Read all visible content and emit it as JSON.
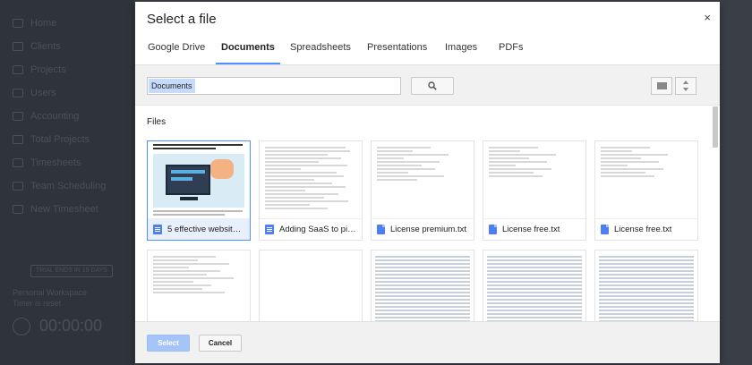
{
  "background_app": {
    "sidebar_items": [
      "Home",
      "Clients",
      "Projects",
      "Users",
      "Accounting",
      "Total Projects",
      "Timesheets",
      "Team Scheduling",
      "New Timesheet"
    ],
    "trial_badge": "TRIAL ENDS IN 15 DAYS",
    "status_line_1": "Personal Workspace",
    "status_line_2": "Timer is reset",
    "timer": "00:00:00"
  },
  "modal": {
    "title": "Select a file",
    "close_symbol": "×",
    "tabs": [
      {
        "label": "Google Drive",
        "active": false
      },
      {
        "label": "Documents",
        "active": true
      },
      {
        "label": "Spreadsheets",
        "active": false
      },
      {
        "label": "Presentations",
        "active": false
      },
      {
        "label": "Images",
        "active": false
      },
      {
        "label": "PDFs",
        "active": false
      }
    ],
    "search": {
      "value": "Documents"
    },
    "section_label": "Files",
    "files": [
      {
        "name": "5 effective website ...",
        "icon": "doc-icon",
        "selected": true
      },
      {
        "name": "Adding SaaS to pick...",
        "icon": "doc-icon",
        "selected": false
      },
      {
        "name": "License premium.txt",
        "icon": "txt-icon",
        "selected": false
      },
      {
        "name": "License free.txt",
        "icon": "txt-icon",
        "selected": false
      },
      {
        "name": "License free.txt",
        "icon": "txt-icon",
        "selected": false
      }
    ],
    "footer": {
      "select_label": "Select",
      "cancel_label": "Cancel"
    }
  },
  "colors": {
    "accent": "#4d90fe",
    "select_disabled": "#a5c4f7"
  }
}
